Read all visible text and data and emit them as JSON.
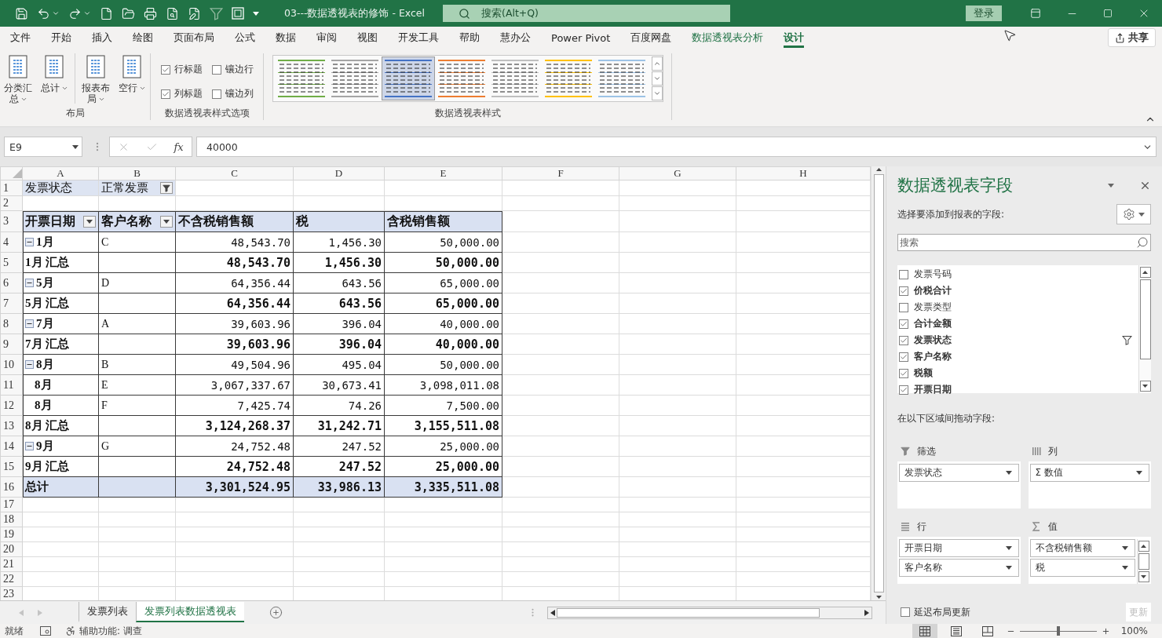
{
  "title_bar": {
    "title": "03---数据透视表的修饰  -  Excel",
    "search_placeholder": "搜索(Alt+Q)",
    "login": "登录"
  },
  "menu_tabs": [
    {
      "label": "文件",
      "selected": false,
      "kind": "normal"
    },
    {
      "label": "开始",
      "selected": false,
      "kind": "normal"
    },
    {
      "label": "插入",
      "selected": false,
      "kind": "normal"
    },
    {
      "label": "绘图",
      "selected": false,
      "kind": "normal"
    },
    {
      "label": "页面布局",
      "selected": false,
      "kind": "normal"
    },
    {
      "label": "公式",
      "selected": false,
      "kind": "normal"
    },
    {
      "label": "数据",
      "selected": false,
      "kind": "normal"
    },
    {
      "label": "审阅",
      "selected": false,
      "kind": "normal"
    },
    {
      "label": "视图",
      "selected": false,
      "kind": "normal"
    },
    {
      "label": "开发工具",
      "selected": false,
      "kind": "normal"
    },
    {
      "label": "帮助",
      "selected": false,
      "kind": "normal"
    },
    {
      "label": "慧办公",
      "selected": false,
      "kind": "normal"
    },
    {
      "label": "Power Pivot",
      "selected": false,
      "kind": "normal"
    },
    {
      "label": "百度网盘",
      "selected": false,
      "kind": "normal"
    },
    {
      "label": "数据透视表分析",
      "selected": false,
      "kind": "contextual"
    },
    {
      "label": "设计",
      "selected": true,
      "kind": "contextual"
    }
  ],
  "share": "共享",
  "ribbon": {
    "layout": {
      "label": "布局",
      "buttons": [
        "分类汇总",
        "总计",
        "报表布局",
        "空行"
      ]
    },
    "options": {
      "label": "数据透视表样式选项",
      "checkboxes": [
        {
          "label": "行标题",
          "checked": true
        },
        {
          "label": "镶边行",
          "checked": false
        },
        {
          "label": "列标题",
          "checked": true
        },
        {
          "label": "镶边列",
          "checked": false
        }
      ]
    },
    "styles": {
      "label": "数据透视表样式",
      "items": [
        {
          "color": "#70ad47",
          "selected": false
        },
        {
          "color": "#a5a5a5",
          "selected": false
        },
        {
          "color": "#4472c4",
          "selected": true
        },
        {
          "color": "#ed7d31",
          "selected": false
        },
        {
          "color": "#bfbfbf",
          "selected": false
        },
        {
          "color": "#ffc000",
          "selected": false
        },
        {
          "color": "#9dc3e6",
          "selected": false
        }
      ]
    }
  },
  "formula_bar": {
    "name_box": "E9",
    "fx": "fx",
    "formula": "40000"
  },
  "sheet": {
    "columns": [
      "A",
      "B",
      "C",
      "D",
      "E",
      "F",
      "G",
      "H"
    ],
    "rows": [
      {
        "number": "1",
        "kind": "filter",
        "cells": {
          "A": "发票状态",
          "B": {
            "text": "正常发票",
            "filter_button": true,
            "filtered": true
          }
        }
      },
      {
        "number": "2",
        "kind": "blank"
      },
      {
        "number": "3",
        "kind": "header",
        "cells": {
          "A": {
            "text": "开票日期",
            "filter_button": true,
            "filtered": false
          },
          "B": {
            "text": "客户名称",
            "filter_button": true,
            "filtered": false
          },
          "C": "不含税销售额",
          "D": "税",
          "E": "含税销售额"
        }
      },
      {
        "number": "4",
        "kind": "item",
        "expanded": true,
        "cells": {
          "A": "1月",
          "B": "C",
          "C": "48,543.70",
          "D": "1,456.30",
          "E": "50,000.00"
        }
      },
      {
        "number": "5",
        "kind": "subtotal",
        "cells": {
          "A": "1月 汇总",
          "C": "48,543.70",
          "D": "1,456.30",
          "E": "50,000.00"
        }
      },
      {
        "number": "6",
        "kind": "item",
        "expanded": true,
        "cells": {
          "A": "5月",
          "B": "D",
          "C": "64,356.44",
          "D": "643.56",
          "E": "65,000.00"
        }
      },
      {
        "number": "7",
        "kind": "subtotal",
        "cells": {
          "A": "5月 汇总",
          "C": "64,356.44",
          "D": "643.56",
          "E": "65,000.00"
        }
      },
      {
        "number": "8",
        "kind": "item",
        "expanded": true,
        "cells": {
          "A": "7月",
          "B": "A",
          "C": "39,603.96",
          "D": "396.04",
          "E": "40,000.00"
        }
      },
      {
        "number": "9",
        "kind": "subtotal",
        "cells": {
          "A": "7月 汇总",
          "C": "39,603.96",
          "D": "396.04",
          "E": "40,000.00"
        }
      },
      {
        "number": "10",
        "kind": "item",
        "expanded": true,
        "cells": {
          "A": "8月",
          "B": "B",
          "C": "49,504.96",
          "D": "495.04",
          "E": "50,000.00"
        }
      },
      {
        "number": "11",
        "kind": "repeat",
        "cells": {
          "A": "8月",
          "B": "E",
          "C": "3,067,337.67",
          "D": "30,673.41",
          "E": "3,098,011.08"
        }
      },
      {
        "number": "12",
        "kind": "repeat",
        "cells": {
          "A": "8月",
          "B": "F",
          "C": "7,425.74",
          "D": "74.26",
          "E": "7,500.00"
        }
      },
      {
        "number": "13",
        "kind": "subtotal",
        "cells": {
          "A": "8月 汇总",
          "C": "3,124,268.37",
          "D": "31,242.71",
          "E": "3,155,511.08"
        }
      },
      {
        "number": "14",
        "kind": "item",
        "expanded": true,
        "cells": {
          "A": "9月",
          "B": "G",
          "C": "24,752.48",
          "D": "247.52",
          "E": "25,000.00"
        }
      },
      {
        "number": "15",
        "kind": "subtotal",
        "cells": {
          "A": "9月 汇总",
          "C": "24,752.48",
          "D": "247.52",
          "E": "25,000.00"
        }
      },
      {
        "number": "16",
        "kind": "total",
        "cells": {
          "A": "总计",
          "C": "3,301,524.95",
          "D": "33,986.13",
          "E": "3,335,511.08"
        }
      },
      {
        "number": "17",
        "kind": "blank"
      },
      {
        "number": "18",
        "kind": "blank"
      },
      {
        "number": "19",
        "kind": "blank"
      },
      {
        "number": "20",
        "kind": "blank"
      },
      {
        "number": "21",
        "kind": "blank"
      },
      {
        "number": "22",
        "kind": "blank"
      },
      {
        "number": "23",
        "kind": "blank"
      }
    ]
  },
  "sheet_tabs": [
    {
      "label": "发票列表",
      "selected": false
    },
    {
      "label": "发票列表数据透视表",
      "selected": true
    }
  ],
  "field_pane": {
    "title": "数据透视表字段",
    "subtitle": "选择要添加到报表的字段:",
    "search_placeholder": "搜索",
    "fields": [
      {
        "label": "发票号码",
        "checked": false,
        "filtered": false
      },
      {
        "label": "价税合计",
        "checked": true,
        "filtered": false
      },
      {
        "label": "发票类型",
        "checked": false,
        "filtered": false
      },
      {
        "label": "合计金额",
        "checked": true,
        "filtered": false
      },
      {
        "label": "发票状态",
        "checked": true,
        "filtered": true
      },
      {
        "label": "客户名称",
        "checked": true,
        "filtered": false
      },
      {
        "label": "税额",
        "checked": true,
        "filtered": false
      },
      {
        "label": "开票日期",
        "checked": true,
        "filtered": false
      }
    ],
    "drag_hint": "在以下区域间拖动字段:",
    "areas": [
      {
        "kind": "filter",
        "label": "筛选",
        "fields": [
          "发票状态"
        ]
      },
      {
        "kind": "columns",
        "label": "列",
        "fields": [
          "Σ 数值"
        ]
      },
      {
        "kind": "rows",
        "label": "行",
        "fields": [
          "开票日期",
          "客户名称"
        ]
      },
      {
        "kind": "values",
        "label": "值",
        "fields": [
          "不含税销售额",
          "税"
        ]
      }
    ],
    "defer": {
      "label": "延迟布局更新",
      "checked": false
    },
    "update": {
      "label": "更新",
      "disabled": true
    }
  },
  "status_bar": {
    "ready": "就绪",
    "accessibility": "辅助功能: 调查",
    "views": [
      {
        "kind": "normal",
        "selected": true
      },
      {
        "kind": "page_layout",
        "selected": false
      },
      {
        "kind": "page_break",
        "selected": false
      }
    ],
    "zoom_slider": {
      "level": 0.5
    },
    "zoom": "100%"
  }
}
